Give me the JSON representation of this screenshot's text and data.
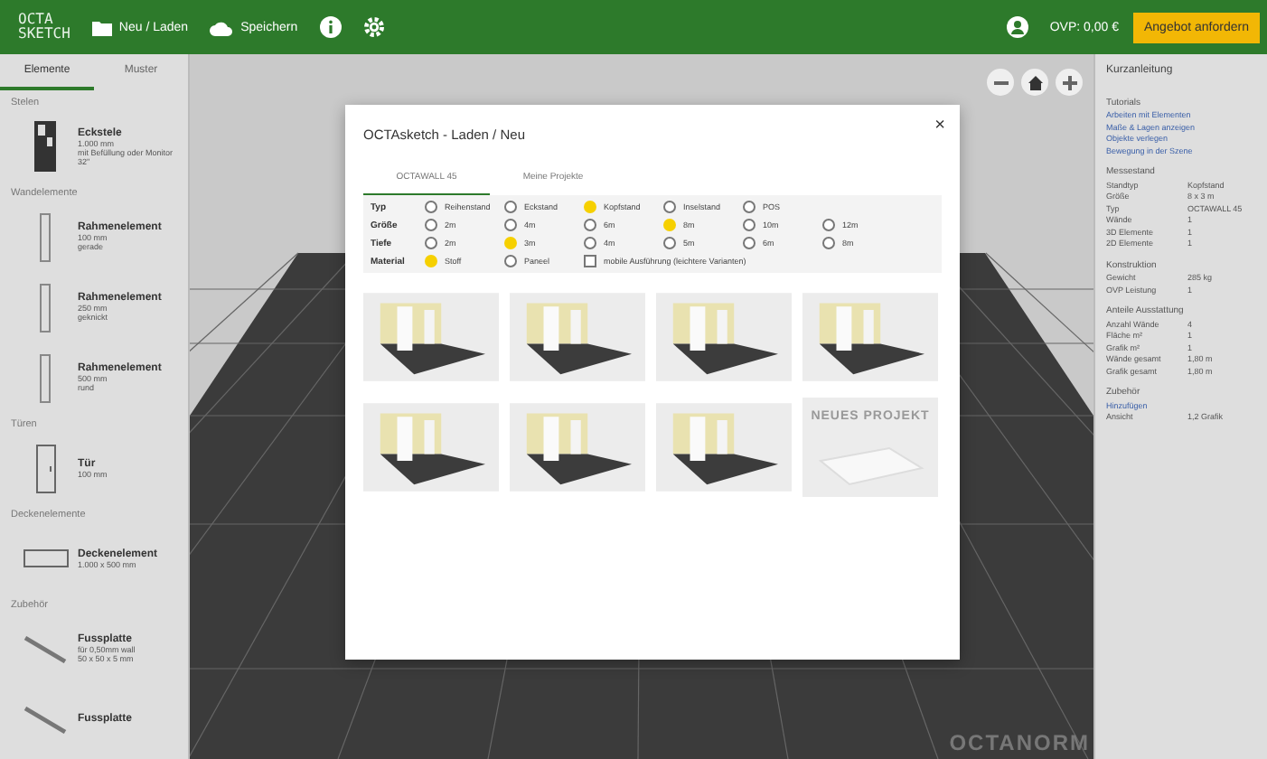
{
  "header": {
    "logo": [
      "OCTA",
      "SKETCH"
    ],
    "menu": [
      {
        "kind": "folder",
        "label": "Neu / Laden"
      },
      {
        "kind": "cloud",
        "label": "Speichern"
      },
      {
        "kind": "info"
      },
      {
        "kind": "gear"
      }
    ],
    "price": "OVP: 0,00 €",
    "cta": "Angebot anfordern"
  },
  "sidebar": {
    "tabs": [
      {
        "label": "Elemente",
        "selected": true
      },
      {
        "label": "Muster",
        "selected": false
      }
    ],
    "sections": [
      {
        "title": "Stelen",
        "items": [
          {
            "kind": "stele",
            "name": "Eckstele",
            "lines": [
              "1.000 mm",
              "mit Befüllung oder Monitor 32\""
            ]
          }
        ]
      },
      {
        "title": "Wandelemente",
        "items": [
          {
            "kind": "frame",
            "name": "Rahmenelement",
            "lines": [
              "100 mm",
              "gerade"
            ]
          },
          {
            "kind": "frame",
            "name": "Rahmenelement",
            "lines": [
              "250 mm",
              "geknickt"
            ]
          },
          {
            "kind": "frame",
            "name": "Rahmenelement",
            "lines": [
              "500 mm",
              "rund"
            ]
          }
        ]
      },
      {
        "title": "Türen",
        "items": [
          {
            "kind": "door",
            "name": "Tür",
            "lines": [
              "100 mm"
            ]
          }
        ]
      },
      {
        "title": "Deckenelemente",
        "items": [
          {
            "kind": "ceiling",
            "name": "Deckenelement",
            "lines": [
              "1.000 x 500 mm"
            ]
          }
        ]
      },
      {
        "title": "Zubehör",
        "items": [
          {
            "kind": "plate",
            "name": "Fussplatte",
            "lines": [
              "für 0,50mm wall",
              "50 x 50 x 5 mm"
            ]
          },
          {
            "kind": "plate",
            "name": "Fussplatte"
          }
        ]
      }
    ]
  },
  "canvas": {
    "buttons": [
      {
        "kind": "minus"
      },
      {
        "kind": "home"
      },
      {
        "kind": "plus"
      }
    ],
    "brand": "OCTANORM"
  },
  "dialog": {
    "title": "OCTAsketch - Laden / Neu",
    "close": "×",
    "tabs": [
      {
        "label": "OCTAWALL 45",
        "selected": true
      },
      {
        "label": "Meine Projekte",
        "selected": false
      }
    ],
    "rows": [
      {
        "label": "Typ",
        "kind": "radio",
        "options": [
          {
            "label": "Reihenstand",
            "selected": false
          },
          {
            "label": "Eckstand",
            "selected": false
          },
          {
            "label": "Kopfstand",
            "selected": true
          },
          {
            "label": "Inselstand",
            "selected": false
          },
          {
            "label": "POS",
            "selected": false
          }
        ]
      },
      {
        "label": "Größe",
        "kind": "radio",
        "options": [
          {
            "label": "2m",
            "selected": false
          },
          {
            "label": "4m",
            "selected": false
          },
          {
            "label": "6m",
            "selected": false
          },
          {
            "label": "8m",
            "selected": true
          },
          {
            "label": "10m",
            "selected": false
          },
          {
            "label": "12m",
            "selected": false
          }
        ]
      },
      {
        "label": "Tiefe",
        "kind": "radio",
        "options": [
          {
            "label": "2m",
            "selected": false
          },
          {
            "label": "3m",
            "selected": true
          },
          {
            "label": "4m",
            "selected": false
          },
          {
            "label": "5m",
            "selected": false
          },
          {
            "label": "6m",
            "selected": false
          },
          {
            "label": "8m",
            "selected": false
          }
        ]
      },
      {
        "label": "Material",
        "kind": "mixed",
        "options": [
          {
            "label": "Stoff",
            "selected": true
          },
          {
            "label": "Paneel",
            "selected": false
          }
        ],
        "checkbox": {
          "label": "mobile Ausführung (leichtere Varianten)",
          "checked": false
        }
      }
    ],
    "projects": [
      {
        "kind": "booth"
      },
      {
        "kind": "booth"
      },
      {
        "kind": "booth"
      },
      {
        "kind": "booth"
      },
      {
        "kind": "booth"
      },
      {
        "kind": "booth"
      },
      {
        "kind": "booth"
      },
      {
        "kind": "new",
        "label": "NEUES PROJEKT"
      }
    ]
  },
  "panel": {
    "title": "Kurzanleitung",
    "sections": [
      {
        "title": "Tutorials",
        "links": [
          "Arbeiten mit Elementen",
          "Maße & Lagen anzeigen",
          "Objekte verlegen",
          "Bewegung in der Szene"
        ]
      },
      {
        "title": "Messestand",
        "rows": [
          [
            "Standtyp",
            "Kopfstand"
          ],
          [
            "Größe",
            "8 x 3 m"
          ],
          [
            "Typ",
            "OCTAWALL 45"
          ],
          [
            "Wände",
            "1"
          ],
          [
            "3D Elemente",
            "1"
          ],
          [
            "2D Elemente",
            "1"
          ]
        ]
      },
      {
        "title": "Konstruktion",
        "rows": [
          [
            "Gewicht",
            "285 kg"
          ],
          [
            "OVP Leistung",
            "1"
          ]
        ]
      },
      {
        "title": "Anteile Ausstattung",
        "rows": [
          [
            "Anzahl Wände",
            "4"
          ],
          [
            "Fläche m²",
            "1"
          ],
          [
            "Grafik m²",
            "1"
          ],
          [
            "Wände gesamt",
            "1,80 m"
          ],
          [
            "Grafik gesamt",
            "1,80 m"
          ]
        ]
      },
      {
        "title": "Zubehör",
        "links": [
          "Hinzufügen"
        ],
        "rows": [
          [
            "Ansicht",
            "1,2 Grafik"
          ]
        ]
      }
    ]
  }
}
